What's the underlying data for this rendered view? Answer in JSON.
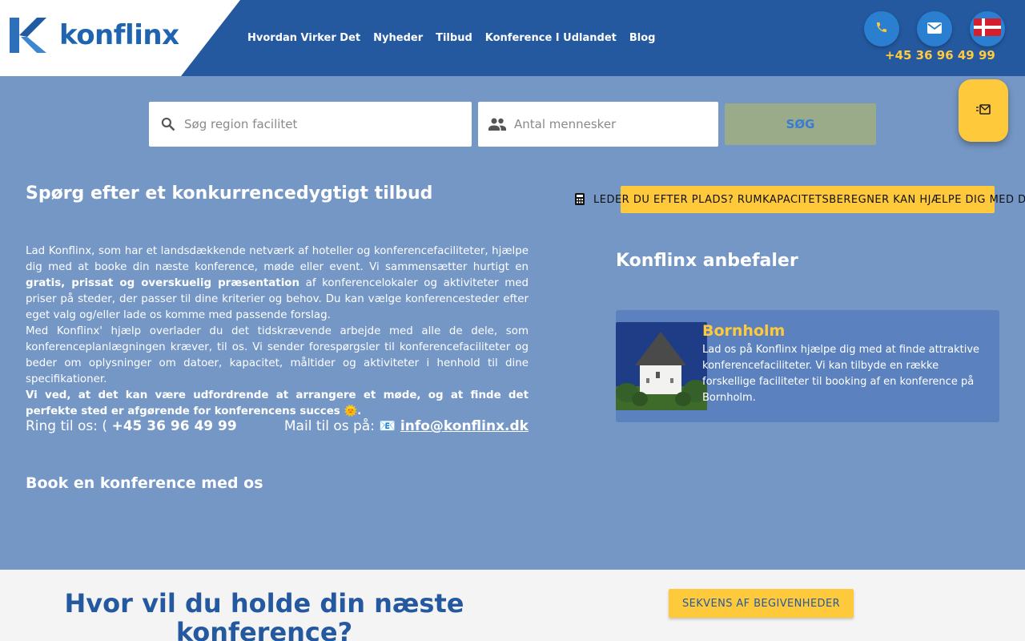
{
  "brand": {
    "name": "konflinx"
  },
  "nav": {
    "items": [
      "Hvordan Virker Det",
      "Nyheder",
      "Tilbud",
      "Konference I Udlandet",
      "Blog"
    ]
  },
  "header": {
    "phone": "+45 36 96 49 99"
  },
  "search": {
    "region_placeholder": "Søg region facilitet",
    "people_placeholder": "Antal mennesker",
    "button_label": "SØG"
  },
  "left": {
    "heading": "Spørg efter et konkurrencedygtigt tilbud",
    "p1_a": "Lad Konflinx, som har et landsdækkende netværk af hoteller og konferencefaciliteter, hjælpe dig med at booke din næste konference, møde eller event. Vi sammensætter hurtigt en ",
    "p1_bold": "gratis, prissat og overskuelig præsentation",
    "p1_b": " af konferencelokaler og aktiviteter med priser på steder, der passer til dine kriterier og behov. Du kan vælge konferencesteder efter eget valg og/eller lade os komme med passende forslag.",
    "p2": "Med Konflinx' hjælp overlader du det tidskrævende arbejde med alle de dele, som konferenceplanlægningen kræver, til os. Vi sender forespørgsler til konferencefaciliteter og beder om oplysninger om datoer, kapacitet, måltider og aktiviteter i henhold til dine specifikationer.",
    "p3": "Vi ved, at det kan være udfordrende at arrangere et møde, og at finde det perfekte sted er afgørende for konferencens succes 🌞.",
    "call_label": "Ring til os: ",
    "call_icon": "(",
    "call_number": "+45 36 96 49 99",
    "mail_label": "Mail til os på: ",
    "mail_icon": "📧",
    "mail_address": "info@konflinx.dk",
    "book_heading": "Book en konference med os"
  },
  "right": {
    "calculator_text": "LEDER DU EFTER PLADS? RUMKAPACITETSBEREGNER KAN HJÆLPE DIG MED DET",
    "recommend_heading": "Konflinx anbefaler",
    "card": {
      "title": "Bornholm",
      "description": "Lad os på Konflinx hjælpe dig med at finde attraktive konferencefaciliteter. Vi kan tilbyde en række forskellige faciliteter til booking af en konference på Bornholm."
    }
  },
  "bottom": {
    "title": "Hvor vil du holde din næste konference?",
    "sequence_button": "SEKVENS AF BEGIVENHEDER"
  },
  "colors": {
    "header_blue": "#24589f",
    "accent_yellow": "#ffc93c",
    "page_blue": "#7597c5"
  }
}
